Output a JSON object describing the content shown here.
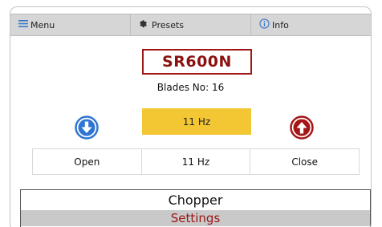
{
  "menubar": {
    "menu_label": "Menu",
    "presets_label": "Presets",
    "info_label": "Info"
  },
  "device": {
    "model": "SR600N",
    "blades_text": "Blades No: 16"
  },
  "frequency": {
    "highlight_value": "11 Hz",
    "row_value": "11 Hz"
  },
  "controls": {
    "open_label": "Open",
    "close_label": "Close"
  },
  "footer": {
    "title": "Chopper",
    "subtitle": "Settings"
  },
  "colors": {
    "model_border": "#a01818",
    "accent_blue": "#2f76d2",
    "accent_red": "#a51616",
    "highlight": "#f3c634"
  }
}
